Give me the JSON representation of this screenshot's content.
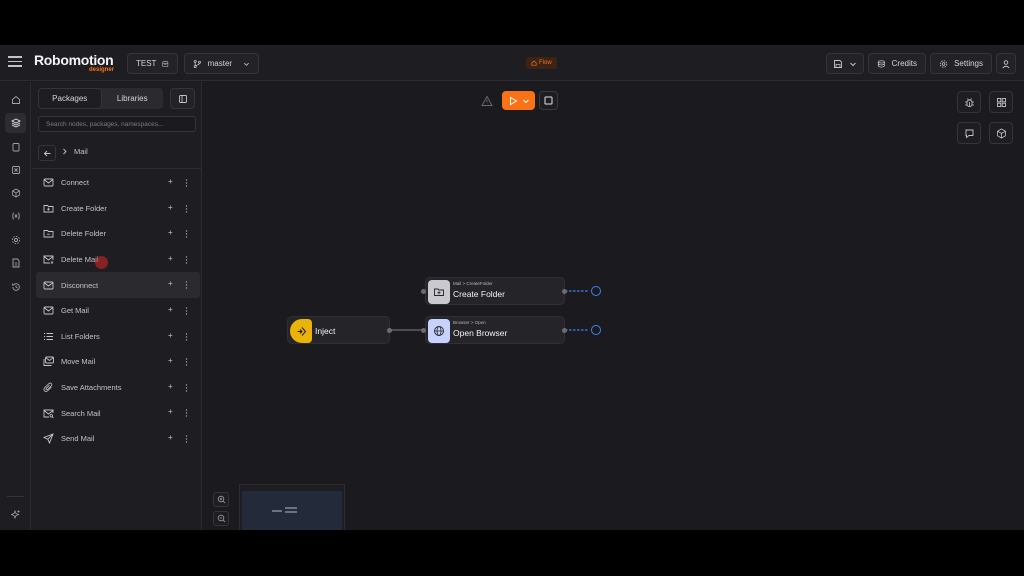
{
  "app": {
    "logo": "Robomotion",
    "logo_sub": "designer"
  },
  "header": {
    "project": "TEST",
    "branch": "master",
    "flow_badge": "Flow",
    "credits_label": "Credits",
    "settings_label": "Settings"
  },
  "panel": {
    "tabs": [
      {
        "label": "Packages",
        "active": true
      },
      {
        "label": "Libraries",
        "active": false
      }
    ],
    "search_placeholder": "Search nodes, packages, namespaces...",
    "breadcrumb": "Mail",
    "items": [
      {
        "label": "Connect",
        "icon": "mail-icon"
      },
      {
        "label": "Create Folder",
        "icon": "folder-plus-icon"
      },
      {
        "label": "Delete Folder",
        "icon": "folder-minus-icon"
      },
      {
        "label": "Delete Mail",
        "icon": "mail-x-icon"
      },
      {
        "label": "Disconnect",
        "icon": "mail-icon"
      },
      {
        "label": "Get Mail",
        "icon": "mail-icon"
      },
      {
        "label": "List Folders",
        "icon": "list-icon"
      },
      {
        "label": "Move Mail",
        "icon": "mails-icon"
      },
      {
        "label": "Save Attachments",
        "icon": "paperclip-icon"
      },
      {
        "label": "Search Mail",
        "icon": "mail-search-icon"
      },
      {
        "label": "Send Mail",
        "icon": "send-icon"
      }
    ]
  },
  "canvas": {
    "nodes": {
      "inject": {
        "title": "Inject",
        "color": "#eab308"
      },
      "create_folder": {
        "subtitle": "Mail > CreateFolder",
        "title": "Create Folder",
        "color": "#c9c9cf"
      },
      "open_browser": {
        "subtitle": "Browser > Open",
        "title": "Open Browser",
        "color": "#c7d2fe"
      }
    },
    "accent_color": "#f97316"
  }
}
